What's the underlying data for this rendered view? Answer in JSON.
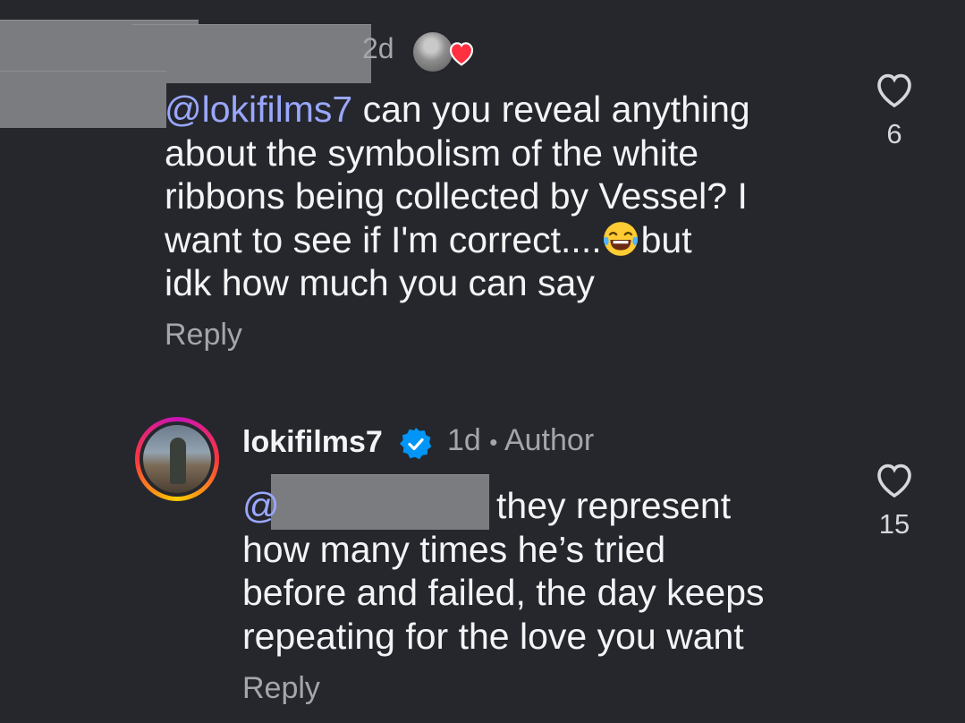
{
  "comment1": {
    "time": "2d",
    "mention": "@lokifilms7",
    "text_line1": "can you reveal anything",
    "text_line2": "about the symbolism of the white",
    "text_line3": "ribbons being collected by Vessel? I",
    "text_line4a": "want to see if I'm correct....",
    "emoji": "face-with-tears-of-joy",
    "text_line4b": "but",
    "text_line5": "idk how much you can say",
    "reply_label": "Reply",
    "like_count": "6"
  },
  "comment2": {
    "username": "lokifilms7",
    "time": "1d",
    "separator": "•",
    "author_label": "Author",
    "mention_symbol": "@",
    "text_line1": "they represent",
    "text_line2": "how many times he’s tried",
    "text_line3": "before and failed, the day keeps",
    "text_line4": "repeating for the love you want",
    "reply_label": "Reply",
    "like_count": "15"
  },
  "colors": {
    "background": "#25272c",
    "mention": "#9aa7ff",
    "muted": "#a3a6ab",
    "liked_heart": "#ff3040",
    "verified": "#0095f6"
  }
}
